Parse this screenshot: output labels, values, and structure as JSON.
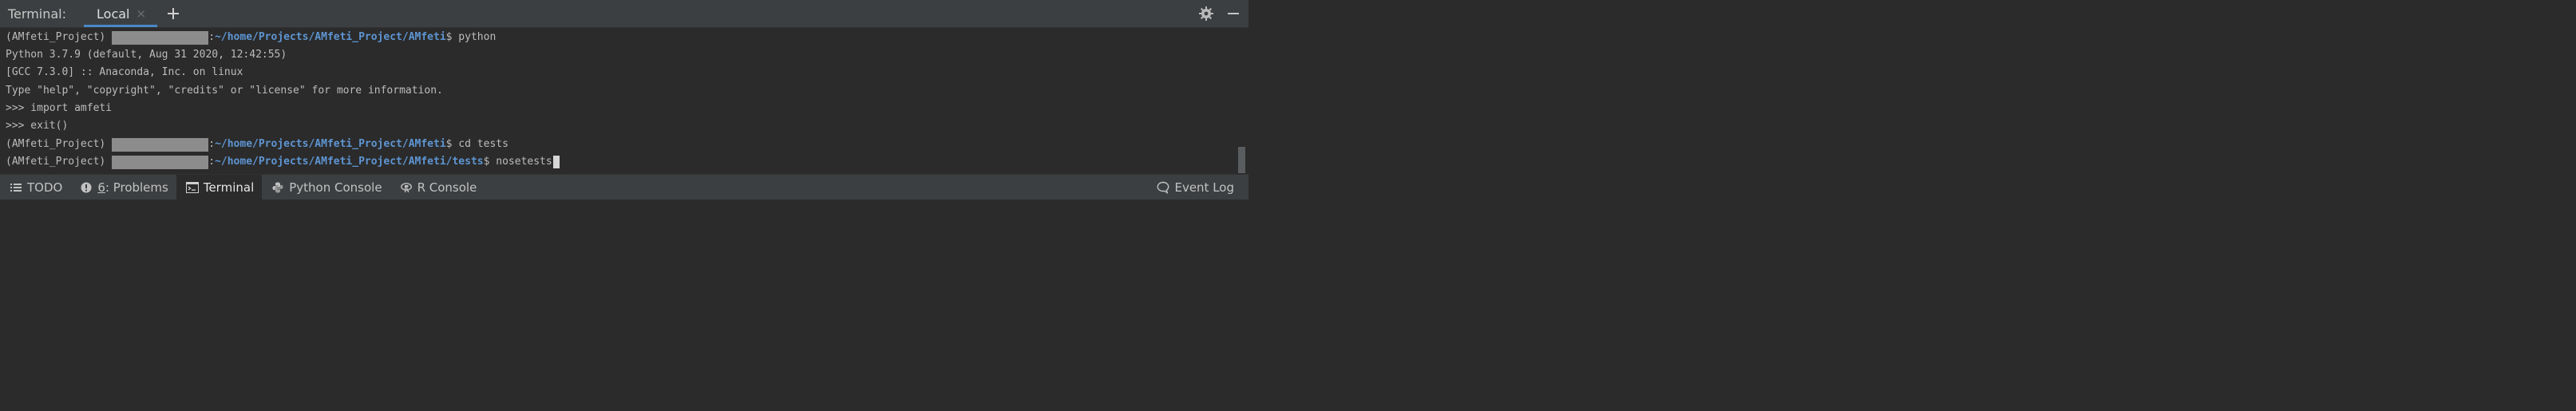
{
  "header": {
    "title": "Terminal:",
    "tab_label": "Local",
    "tab_close": "×"
  },
  "terminal": {
    "lines": [
      {
        "env": "(AMfeti_Project)",
        "sep": ":",
        "path": "~/home/Projects/AMfeti_Project/AMfeti",
        "cmd": "$ python"
      },
      {
        "text": "Python 3.7.9 (default, Aug 31 2020, 12:42:55)"
      },
      {
        "text": "[GCC 7.3.0] :: Anaconda, Inc. on linux"
      },
      {
        "text": "Type \"help\", \"copyright\", \"credits\" or \"license\" for more information."
      },
      {
        "text": ">>> import amfeti"
      },
      {
        "text": ">>> exit()"
      },
      {
        "env": "(AMfeti_Project)",
        "sep": ":",
        "path": "~/home/Projects/AMfeti_Project/AMfeti",
        "cmd": "$ cd tests"
      },
      {
        "env": "(AMfeti_Project)",
        "sep": ":",
        "path": "~/home/Projects/AMfeti_Project/AMfeti/tests",
        "cmd": "$ nosetests"
      }
    ]
  },
  "toolbar": {
    "todo": "TODO",
    "problems_num": "6",
    "problems_label": ": Problems",
    "terminal": "Terminal",
    "python_console": "Python Console",
    "r_console": "R Console",
    "event_log": "Event Log"
  },
  "icons": {
    "todo": "list-icon",
    "problems": "alert-icon",
    "terminal": "terminal-icon",
    "python": "python-icon",
    "r": "r-icon",
    "event_log": "speech-bubble-icon",
    "settings": "gear-icon",
    "minimize": "minimize-icon",
    "add_tab": "plus-icon"
  },
  "colors": {
    "background": "#2b2b2b",
    "panel": "#3c3f41",
    "path": "#5e95d2",
    "tab_underline": "#4a88c7",
    "redaction": "#8c8c8c"
  }
}
